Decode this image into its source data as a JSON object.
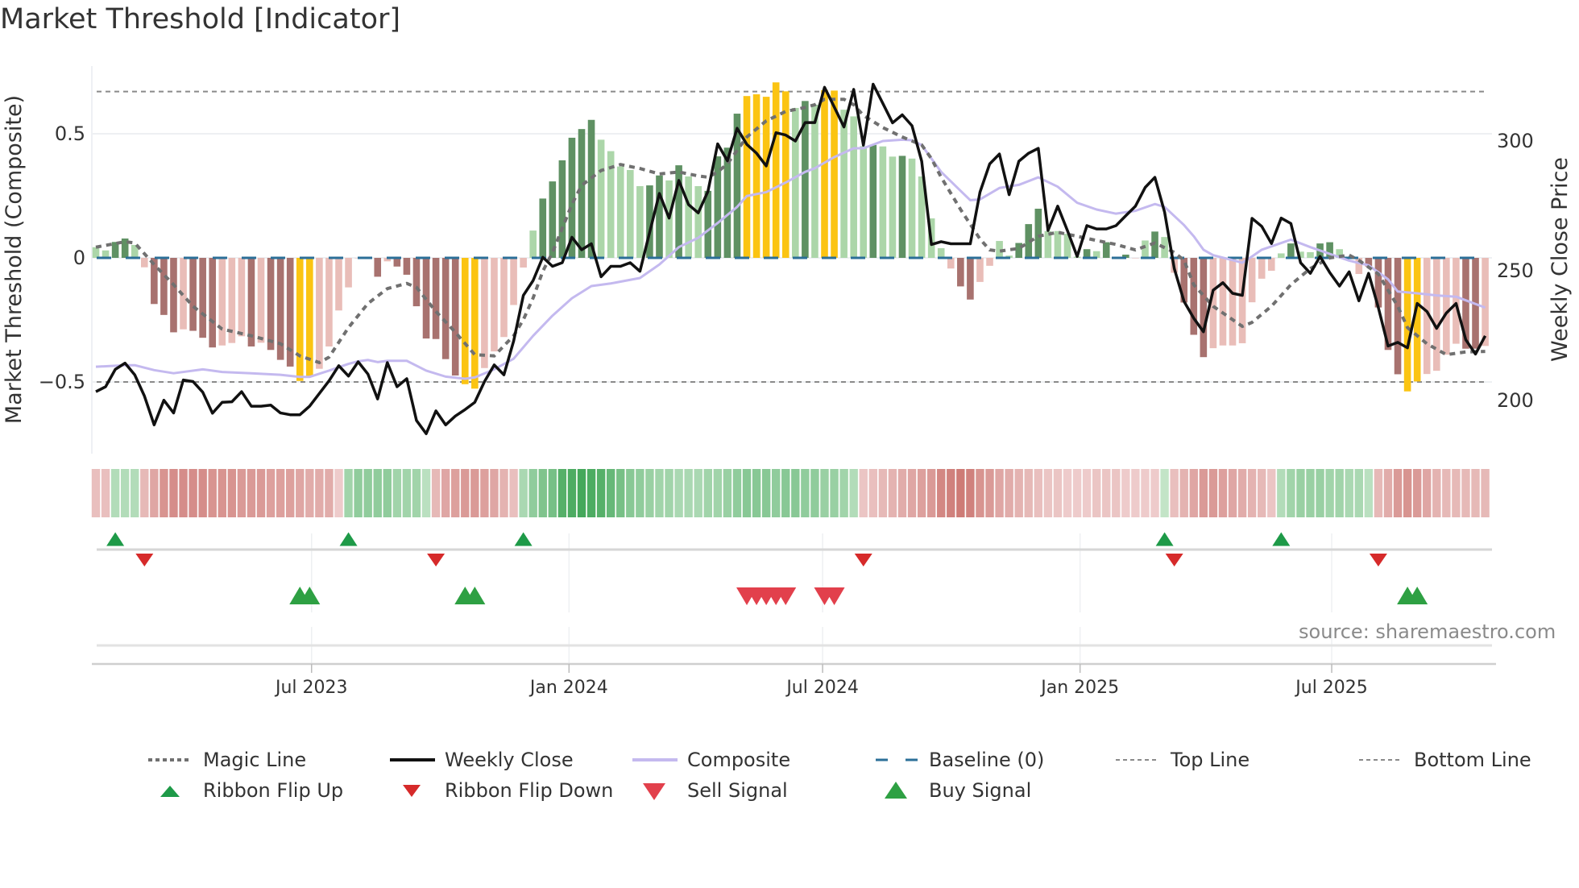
{
  "title": "Market Threshold [Indicator]",
  "source": "source: sharemaestro.com",
  "legend": [
    {
      "key": "magic",
      "label": "Magic Line"
    },
    {
      "key": "close",
      "label": "Weekly Close"
    },
    {
      "key": "composite",
      "label": "Composite"
    },
    {
      "key": "baseline",
      "label": "Baseline (0)"
    },
    {
      "key": "top",
      "label": "Top Line"
    },
    {
      "key": "bottom",
      "label": "Bottom Line"
    },
    {
      "key": "flip_up",
      "label": "Ribbon Flip Up"
    },
    {
      "key": "flip_down",
      "label": "Ribbon Flip Down"
    },
    {
      "key": "sell",
      "label": "Sell Signal"
    },
    {
      "key": "buy",
      "label": "Buy Signal"
    }
  ],
  "colors": {
    "bar_G": "#5f9163",
    "bar_g": "#acd6a9",
    "bar_R": "#a8726f",
    "bar_r": "#e9bdb8",
    "bar_Y": "#fbc412",
    "close": "#111111",
    "composite": "#c4b9ef",
    "magic": "#707070",
    "baseline": "#2b6f98",
    "refline": "#8a8a8a",
    "flip_up": "#1e9a48",
    "flip_down": "#d62a2a",
    "buy": "#2ea043",
    "sell": "#e2404c"
  },
  "chart_data": {
    "type": "bar+line",
    "title": "Market Threshold [Indicator]",
    "ylabel_left": "Market Threshold (Composite)",
    "ylabel_right": "Weekly Close Price",
    "ylim_left": [
      -0.79,
      0.77
    ],
    "ylim_right": [
      179.5,
      329
    ],
    "yticks_left": [
      {
        "value": 0.5,
        "label": "0.5"
      },
      {
        "value": 0,
        "label": "0"
      },
      {
        "value": -0.5,
        "label": "−0.5"
      }
    ],
    "yticks_right": [
      {
        "value": 300,
        "label": "300"
      },
      {
        "value": 250,
        "label": "250"
      },
      {
        "value": 200,
        "label": "200"
      }
    ],
    "x_unit": "week index (1 = first weekly bar)",
    "x_ticks": [
      {
        "label": "Jul 2023",
        "week": 23.2
      },
      {
        "label": "Jan 2024",
        "week": 49.7
      },
      {
        "label": "Jul 2024",
        "week": 75.8
      },
      {
        "label": "Jan 2025",
        "week": 102.3
      },
      {
        "label": "Jul 2025",
        "week": 128.2
      }
    ],
    "baseline": 0,
    "top_line": 0.67,
    "bottom_line": -0.5,
    "composite_bars": [
      0.043,
      0.03,
      0.064,
      0.078,
      0.052,
      -0.038,
      -0.186,
      -0.23,
      -0.3,
      -0.288,
      -0.294,
      -0.322,
      -0.361,
      -0.353,
      -0.343,
      -0.316,
      -0.357,
      -0.342,
      -0.371,
      -0.411,
      -0.438,
      -0.496,
      -0.479,
      -0.447,
      -0.357,
      -0.212,
      -0.119,
      0,
      -0.005,
      -0.076,
      -0.014,
      -0.035,
      -0.068,
      -0.195,
      -0.325,
      -0.327,
      -0.408,
      -0.474,
      -0.509,
      -0.527,
      -0.444,
      -0.377,
      -0.319,
      -0.19,
      -0.039,
      0.11,
      0.239,
      0.308,
      0.393,
      0.484,
      0.519,
      0.556,
      0.476,
      0.43,
      0.368,
      0.354,
      0.289,
      0.292,
      0.332,
      0.312,
      0.373,
      0.328,
      0.289,
      0.27,
      0.409,
      0.444,
      0.581,
      0.652,
      0.659,
      0.649,
      0.707,
      0.671,
      0.604,
      0.632,
      0.617,
      0.676,
      0.674,
      0.597,
      0.57,
      0.45,
      0.455,
      0.449,
      0.408,
      0.411,
      0.4,
      0.328,
      0.159,
      0.039,
      -0.043,
      -0.115,
      -0.168,
      -0.097,
      -0.032,
      0.068,
      0.009,
      0.06,
      0.136,
      0.198,
      0.108,
      0.108,
      0.097,
      0.005,
      0.035,
      0.027,
      0.063,
      0,
      0.013,
      0,
      0.07,
      0.106,
      0.084,
      -0.06,
      -0.18,
      -0.31,
      -0.4,
      -0.364,
      -0.353,
      -0.353,
      -0.344,
      -0.179,
      -0.084,
      -0.052,
      0.018,
      0.058,
      0.025,
      0.023,
      0.058,
      0.063,
      0.035,
      0.005,
      -0.065,
      -0.035,
      -0.2,
      -0.371,
      -0.469,
      -0.538,
      -0.498,
      -0.468,
      -0.455,
      -0.39,
      -0.346,
      -0.366,
      -0.366,
      -0.355
    ],
    "bar_color_codes": "ggGGgrRRRrRRRrrrRrRRRYYrrrrrrRrRRRRRRRYYrrrrrgGGGGGGgggggGGgGggGGGGYYYYYgGgYYgggGggGggggrRRrrggGGGggggGgGgGrgGgrRRRrrrrrrrgGggGGggrRRRRYYrrrrRRr",
    "bar_color_legend": {
      "G": "strong positive",
      "g": "weak positive",
      "R": "strong negative",
      "r": "weak negative",
      "Y": "extreme"
    },
    "weekly_close": [
      203.4,
      205.3,
      212,
      214.4,
      209.9,
      201.7,
      190.6,
      200.1,
      195.2,
      207.9,
      207.3,
      203.2,
      195.1,
      199.3,
      199.5,
      203.4,
      197.8,
      197.8,
      198.2,
      195.2,
      194.5,
      194.5,
      197.8,
      202.7,
      207.6,
      213.4,
      209.4,
      214.9,
      210.2,
      200.6,
      214.6,
      205.3,
      208.4,
      192.3,
      187.2,
      196,
      190.6,
      194,
      196.5,
      199.3,
      207.3,
      213.7,
      209.9,
      222.9,
      240.5,
      246.2,
      255.2,
      251.7,
      253.1,
      262.9,
      258.1,
      260.4,
      247.7,
      251.7,
      251.7,
      253.1,
      249.8,
      264.8,
      279.8,
      270.3,
      284.8,
      275.5,
      272.3,
      280.6,
      298.9,
      292.4,
      304.9,
      298.7,
      295.3,
      290.4,
      303.2,
      302.3,
      300,
      307.1,
      307.1,
      320.7,
      313.1,
      305.4,
      319.9,
      298.4,
      321.9,
      314.5,
      307,
      310.1,
      305.9,
      292.2,
      260.1,
      261.2,
      260.4,
      260.4,
      260.4,
      280.3,
      291.2,
      295,
      279.3,
      292.2,
      295.3,
      297.2,
      265.5,
      274.9,
      265.5,
      255.5,
      267.4,
      266.1,
      266.1,
      267.4,
      271.2,
      274.9,
      282.1,
      286,
      272.6,
      250.8,
      238.2,
      231.7,
      226.5,
      242.5,
      245.4,
      241.3,
      240.5,
      270.2,
      267.1,
      260.5,
      270.3,
      268.2,
      253.1,
      249,
      255.5,
      249.3,
      244.1,
      249.6,
      238.4,
      249,
      235.8,
      221,
      222.4,
      220.3,
      237.4,
      234.3,
      227.8,
      233.7,
      237.4,
      223.4,
      217.9,
      224.9
    ],
    "magic_line": [
      [
        1,
        0.043
      ],
      [
        4,
        0.065
      ],
      [
        5,
        0.06
      ],
      [
        7,
        -0.027
      ],
      [
        9,
        -0.108
      ],
      [
        11,
        -0.195
      ],
      [
        14,
        -0.287
      ],
      [
        17,
        -0.314
      ],
      [
        20,
        -0.346
      ],
      [
        22,
        -0.395
      ],
      [
        24,
        -0.422
      ],
      [
        25,
        -0.4
      ],
      [
        27,
        -0.281
      ],
      [
        29,
        -0.184
      ],
      [
        31,
        -0.124
      ],
      [
        33,
        -0.103
      ],
      [
        34,
        -0.119
      ],
      [
        36,
        -0.216
      ],
      [
        38,
        -0.3
      ],
      [
        40,
        -0.39
      ],
      [
        42,
        -0.395
      ],
      [
        44,
        -0.314
      ],
      [
        45,
        -0.249
      ],
      [
        46,
        -0.162
      ],
      [
        47,
        -0.054
      ],
      [
        48,
        0.022
      ],
      [
        49,
        0.119
      ],
      [
        50,
        0.216
      ],
      [
        51,
        0.292
      ],
      [
        53,
        0.352
      ],
      [
        55,
        0.376
      ],
      [
        57,
        0.36
      ],
      [
        59,
        0.338
      ],
      [
        61,
        0.346
      ],
      [
        63,
        0.33
      ],
      [
        64,
        0.325
      ],
      [
        65,
        0.346
      ],
      [
        66,
        0.379
      ],
      [
        67,
        0.433
      ],
      [
        68,
        0.487
      ],
      [
        70,
        0.552
      ],
      [
        72,
        0.59
      ],
      [
        74,
        0.606
      ],
      [
        75,
        0.617
      ],
      [
        76,
        0.639
      ],
      [
        78,
        0.639
      ],
      [
        79,
        0.617
      ],
      [
        80,
        0.574
      ],
      [
        82,
        0.525
      ],
      [
        84,
        0.487
      ],
      [
        85,
        0.471
      ],
      [
        86,
        0.455
      ],
      [
        87,
        0.4
      ],
      [
        88,
        0.325
      ],
      [
        90,
        0.195
      ],
      [
        92,
        0.076
      ],
      [
        93,
        0.032
      ],
      [
        94,
        0.027
      ],
      [
        96,
        0.038
      ],
      [
        98,
        0.087
      ],
      [
        100,
        0.103
      ],
      [
        102,
        0.087
      ],
      [
        104,
        0.07
      ],
      [
        106,
        0.054
      ],
      [
        108,
        0.032
      ],
      [
        110,
        0.06
      ],
      [
        112,
        0.022
      ],
      [
        113,
        -0.01
      ],
      [
        114,
        -0.108
      ],
      [
        116,
        -0.195
      ],
      [
        118,
        -0.249
      ],
      [
        119,
        -0.276
      ],
      [
        120,
        -0.26
      ],
      [
        122,
        -0.195
      ],
      [
        124,
        -0.108
      ],
      [
        126,
        -0.043
      ],
      [
        128,
        0
      ],
      [
        130,
        0.011
      ],
      [
        131,
        -0.01
      ],
      [
        133,
        -0.065
      ],
      [
        135,
        -0.195
      ],
      [
        136,
        -0.281
      ],
      [
        138,
        -0.346
      ],
      [
        140,
        -0.39
      ],
      [
        142,
        -0.379
      ],
      [
        144,
        -0.377
      ]
    ],
    "composite_line": [
      [
        1,
        213
      ],
      [
        4,
        213.6
      ],
      [
        5,
        213.6
      ],
      [
        7,
        211.7
      ],
      [
        9,
        210.5
      ],
      [
        12,
        212
      ],
      [
        14,
        211
      ],
      [
        17,
        210.5
      ],
      [
        20,
        209.9
      ],
      [
        22,
        209.1
      ],
      [
        23,
        209.1
      ],
      [
        25,
        211.5
      ],
      [
        27,
        214.1
      ],
      [
        28,
        215.1
      ],
      [
        29,
        215.6
      ],
      [
        30,
        214.8
      ],
      [
        31,
        215.3
      ],
      [
        33,
        215.3
      ],
      [
        35,
        211.5
      ],
      [
        37,
        209.2
      ],
      [
        39,
        208.4
      ],
      [
        40,
        208.9
      ],
      [
        42,
        212
      ],
      [
        44,
        216.1
      ],
      [
        46,
        224.9
      ],
      [
        48,
        232.7
      ],
      [
        50,
        239.4
      ],
      [
        52,
        244.1
      ],
      [
        54,
        245.1
      ],
      [
        57,
        247.2
      ],
      [
        59,
        252.4
      ],
      [
        61,
        259.1
      ],
      [
        63,
        262.7
      ],
      [
        65,
        268.4
      ],
      [
        67,
        274.6
      ],
      [
        68,
        278.8
      ],
      [
        70,
        280.3
      ],
      [
        72,
        284
      ],
      [
        74,
        288.1
      ],
      [
        75,
        289.5
      ],
      [
        77,
        293.8
      ],
      [
        79,
        297.2
      ],
      [
        80,
        297.2
      ],
      [
        82,
        300
      ],
      [
        84,
        300.5
      ],
      [
        85,
        300.3
      ],
      [
        86,
        298.4
      ],
      [
        88,
        288.1
      ],
      [
        90,
        280.8
      ],
      [
        91,
        277.2
      ],
      [
        92,
        277.5
      ],
      [
        94,
        281.9
      ],
      [
        96,
        283.1
      ],
      [
        98,
        286
      ],
      [
        100,
        282.4
      ],
      [
        102,
        276.2
      ],
      [
        104,
        273.6
      ],
      [
        106,
        272
      ],
      [
        108,
        273.1
      ],
      [
        110,
        275.7
      ],
      [
        111,
        274.6
      ],
      [
        113,
        267.6
      ],
      [
        114,
        263.3
      ],
      [
        115,
        258.1
      ],
      [
        116,
        256
      ],
      [
        118,
        254.1
      ],
      [
        119,
        253.1
      ],
      [
        120,
        255.5
      ],
      [
        121,
        258.1
      ],
      [
        123,
        260.7
      ],
      [
        124,
        262
      ],
      [
        126,
        259.1
      ],
      [
        128,
        256.5
      ],
      [
        130,
        253.9
      ],
      [
        132,
        252.1
      ],
      [
        134,
        246.7
      ],
      [
        135,
        242
      ],
      [
        137,
        241.3
      ],
      [
        139,
        240.5
      ],
      [
        141,
        240
      ],
      [
        142,
        238.6
      ],
      [
        144,
        235.8
      ]
    ],
    "ribbon": [
      -0.25,
      -0.25,
      0.25,
      0.25,
      0.25,
      -0.3,
      -0.45,
      -0.6,
      -0.65,
      -0.65,
      -0.65,
      -0.65,
      -0.6,
      -0.6,
      -0.6,
      -0.55,
      -0.55,
      -0.55,
      -0.5,
      -0.5,
      -0.5,
      -0.45,
      -0.4,
      -0.4,
      -0.4,
      -0.15,
      0.35,
      0.45,
      0.45,
      0.45,
      0.45,
      0.35,
      0.35,
      0.35,
      0.2,
      -0.3,
      -0.45,
      -0.5,
      -0.55,
      -0.55,
      -0.5,
      -0.45,
      -0.35,
      -0.25,
      0.3,
      0.45,
      0.55,
      0.6,
      0.8,
      0.85,
      0.9,
      0.85,
      0.8,
      0.7,
      0.6,
      0.5,
      0.45,
      0.4,
      0.35,
      0.35,
      0.3,
      0.3,
      0.3,
      0.35,
      0.35,
      0.4,
      0.45,
      0.5,
      0.5,
      0.5,
      0.45,
      0.5,
      0.5,
      0.45,
      0.45,
      0.4,
      0.4,
      0.35,
      0.25,
      -0.2,
      -0.25,
      -0.3,
      -0.35,
      -0.4,
      -0.45,
      -0.5,
      -0.55,
      -0.7,
      -0.75,
      -0.8,
      -0.75,
      -0.6,
      -0.55,
      -0.45,
      -0.4,
      -0.35,
      -0.3,
      -0.25,
      -0.2,
      -0.2,
      -0.15,
      -0.15,
      -0.15,
      -0.2,
      -0.2,
      -0.2,
      -0.15,
      -0.15,
      -0.15,
      -0.15,
      0.15,
      -0.25,
      -0.35,
      -0.45,
      -0.55,
      -0.55,
      -0.5,
      -0.45,
      -0.4,
      -0.35,
      -0.3,
      -0.2,
      0.25,
      0.35,
      0.4,
      0.4,
      0.4,
      0.35,
      0.35,
      0.3,
      0.3,
      0.2,
      -0.3,
      -0.4,
      -0.55,
      -0.6,
      -0.55,
      -0.45,
      -0.35,
      -0.3,
      -0.3,
      -0.3,
      -0.3,
      -0.3
    ],
    "ribbon_flip_up": [
      3,
      27,
      45,
      111,
      123
    ],
    "ribbon_flip_down": [
      6,
      36,
      80,
      112,
      133
    ],
    "buy_signals": [
      22,
      23,
      39,
      40,
      136,
      137
    ],
    "sell_signals": [
      68,
      69,
      70,
      71,
      72,
      76,
      77
    ]
  }
}
